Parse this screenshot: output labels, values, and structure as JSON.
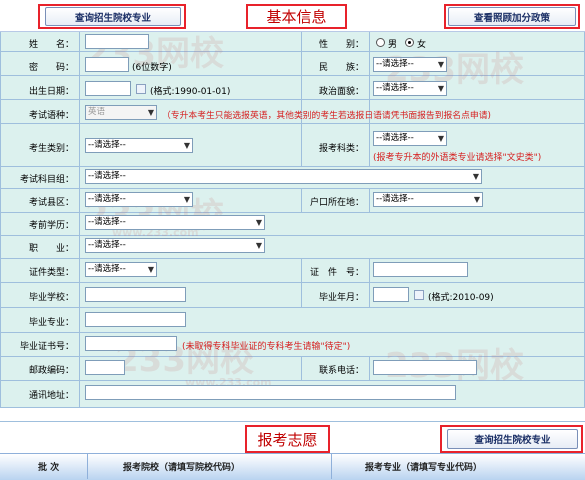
{
  "header": {
    "query_schools_label": "查询招生院校专业",
    "title": "基本信息",
    "bonus_policy_label": "查看照顾加分政策"
  },
  "form": {
    "name_label": "姓　　名：",
    "gender_label": "性　　别：",
    "gender_male": "男",
    "gender_female": "女",
    "password_label": "密　　码：",
    "password_hint": "(6位数字)",
    "ethnicity_label": "民　　族：",
    "ethnicity_value": "--请选择--",
    "birthday_label": "出生日期：",
    "birthday_hint": "(格式:1990-01-01)",
    "politics_label": "政治面貌：",
    "politics_value": "--请选择--",
    "language_label": "考试语种：",
    "language_value": "英语",
    "language_note": "（专升本考生只能选报英语，其他类别的考生若选报日语请凭书面报告到报名点申请)",
    "category_label": "考生类别：",
    "category_value": "--请选择--",
    "subject_label": "报考科类：",
    "subject_value": "--请选择--",
    "subject_note": "(报考专升本的外语类专业请选择\"文史类\")",
    "group_label": "考试科目组：",
    "group_value": "--请选择--",
    "county_label": "考试县区：",
    "county_value": "--请选择--",
    "hukou_label": "户口所在地：",
    "hukou_value": "--请选择--",
    "education_label": "考前学历：",
    "education_value": "--请选择--",
    "job_label": "职　　业：",
    "job_value": "--请选择--",
    "id_type_label": "证件类型：",
    "id_type_value": "--请选择--",
    "id_number_label": "证　件　号：",
    "school_label": "毕业学校：",
    "grad_date_label": "毕业年月：",
    "grad_date_hint": "(格式:2010-09)",
    "major_label": "毕业专业：",
    "cert_label": "毕业证书号：",
    "cert_note": "(未取得专科毕业证的专科考生请输\"待定\")",
    "postcode_label": "邮政编码：",
    "phone_label": "联系电话：",
    "address_label": "通讯地址："
  },
  "watermark": {
    "brand": "233网校",
    "url": "www.233.com"
  },
  "wishes": {
    "title": "报考志愿",
    "query_schools_label": "查询招生院校专业",
    "col_batch": "批 次",
    "col_school": "报考院校（请填写院校代码）",
    "col_major": "报考专业（请填写专业代码）"
  },
  "colors": {
    "form_bg": "#dcf1ee",
    "grid_line": "#9fbfdd",
    "title_red": "#c00000",
    "note_red": "#d61f1f",
    "highlight_frame": "#e8222b"
  }
}
